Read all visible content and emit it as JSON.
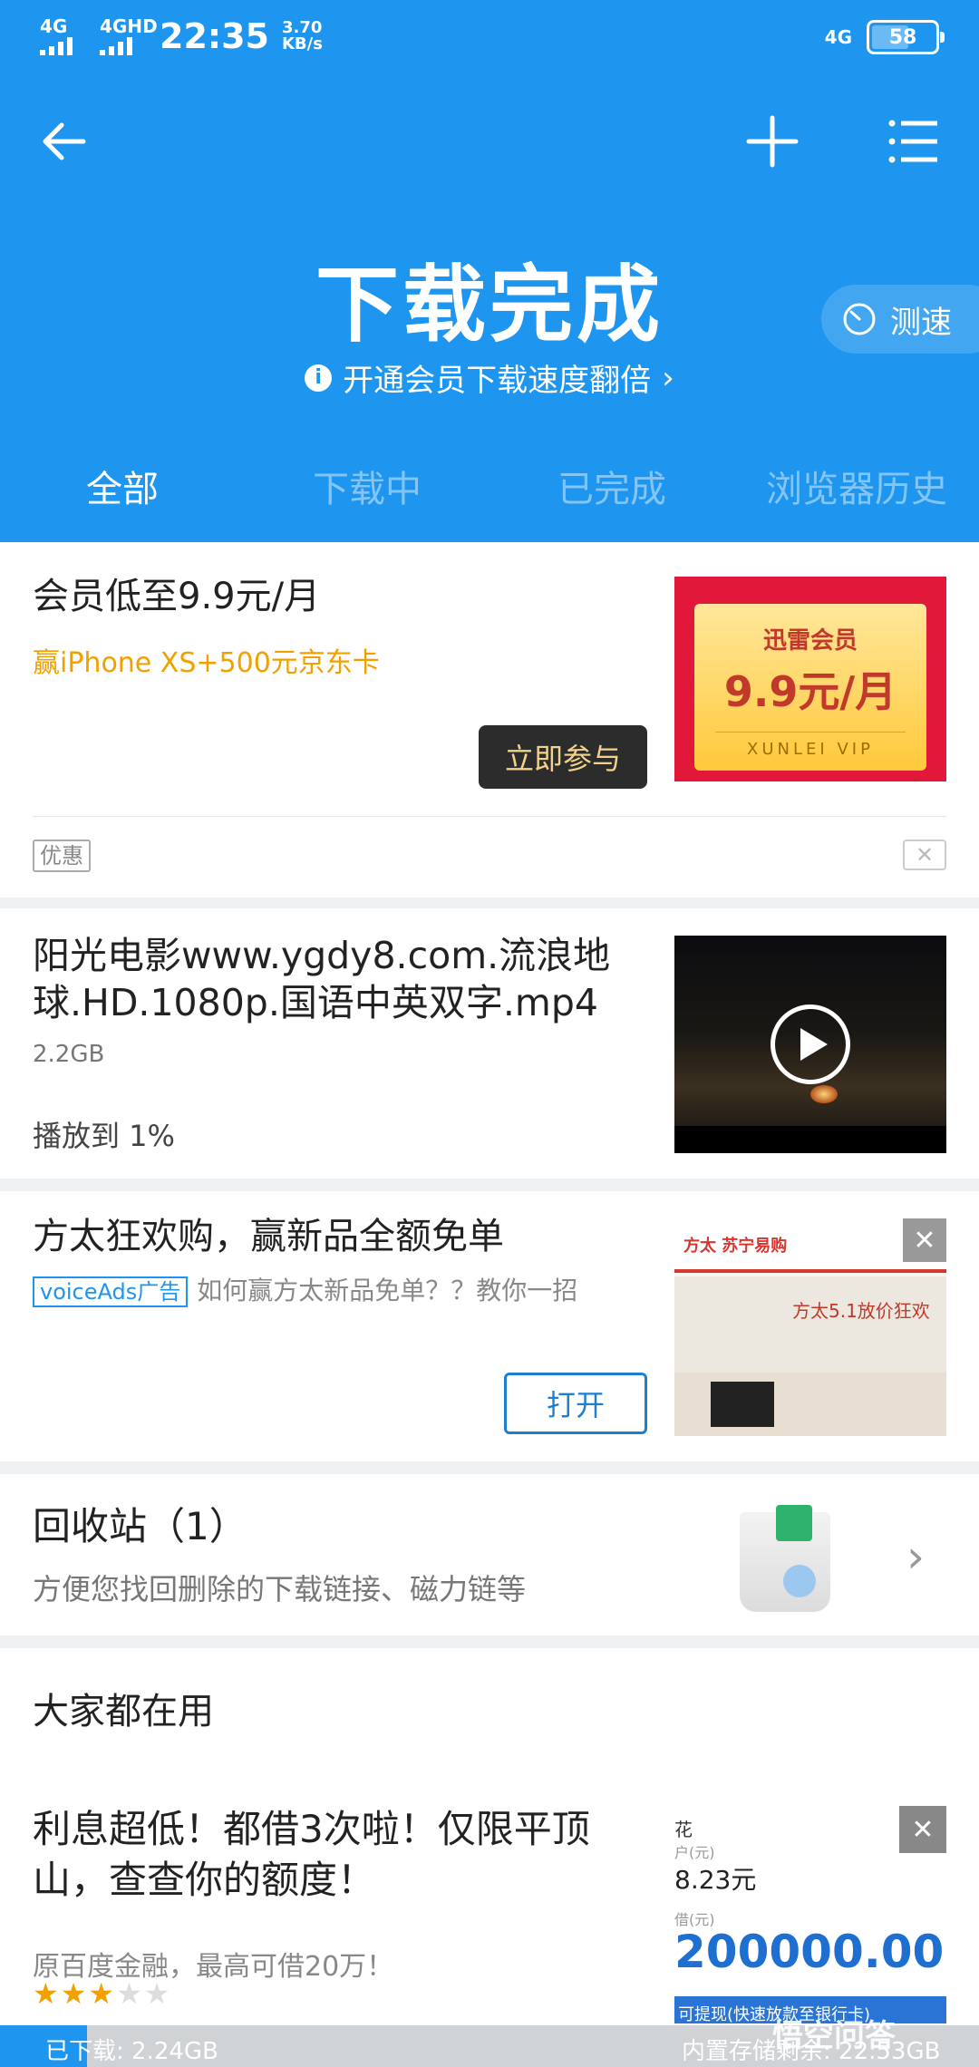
{
  "status_bar": {
    "signal1": "4G",
    "signal2": "4GHD",
    "time": "22:35",
    "net_speed_value": "3.70",
    "net_speed_unit": "KB/s",
    "network": "4G",
    "battery": "58"
  },
  "header": {
    "title": "下载完成",
    "vip_promo": "开通会员下载速度翻倍",
    "speed_test": "测速",
    "tabs": [
      "全部",
      "下载中",
      "已完成",
      "浏览器历史"
    ],
    "active_tab": 0
  },
  "promo_card": {
    "title": "会员低至9.9元/月",
    "subtitle": "赢iPhone XS+500元京东卡",
    "button": "立即参与",
    "image_line1": "迅雷会员",
    "image_line2": "9.9元/月",
    "image_line3": "XUNLEI VIP",
    "tag": "优惠"
  },
  "video_item": {
    "title": "阳光电影www.ygdy8.com.流浪地球.HD.1080p.国语中英双字.mp4",
    "size": "2.2GB",
    "progress_text": "播放到 1%"
  },
  "ad_card": {
    "title": "方太狂欢购，赢新品全额免单",
    "label": "voiceAds广告",
    "desc": "如何赢方太新品免单？？教你一招",
    "button": "打开",
    "image_brand": "方太 苏宁易购",
    "image_slogan": "方太5.1放价狂欢"
  },
  "recycle": {
    "title": "回收站（1）",
    "desc": "方便您找回删除的下载链接、磁力链等"
  },
  "section": {
    "title": "大家都在用"
  },
  "loan_card": {
    "title": "利息超低！都借3次啦！仅限平顶山，查查你的额度！",
    "desc": "原百度金融，最高可借20万！",
    "rating": 3,
    "rating_max": 5,
    "image_l1": "花",
    "image_l2": "户(元)",
    "image_l3": "8.23元",
    "image_l4": "借(元)",
    "image_l5": "200000.00",
    "image_l6": "可提现(快速放款至银行卡)"
  },
  "bottom_bar": {
    "downloaded": "已下载: 2.24GB",
    "storage": "内置存储剩余: 22.53GB",
    "watermark": "悟空问答"
  }
}
